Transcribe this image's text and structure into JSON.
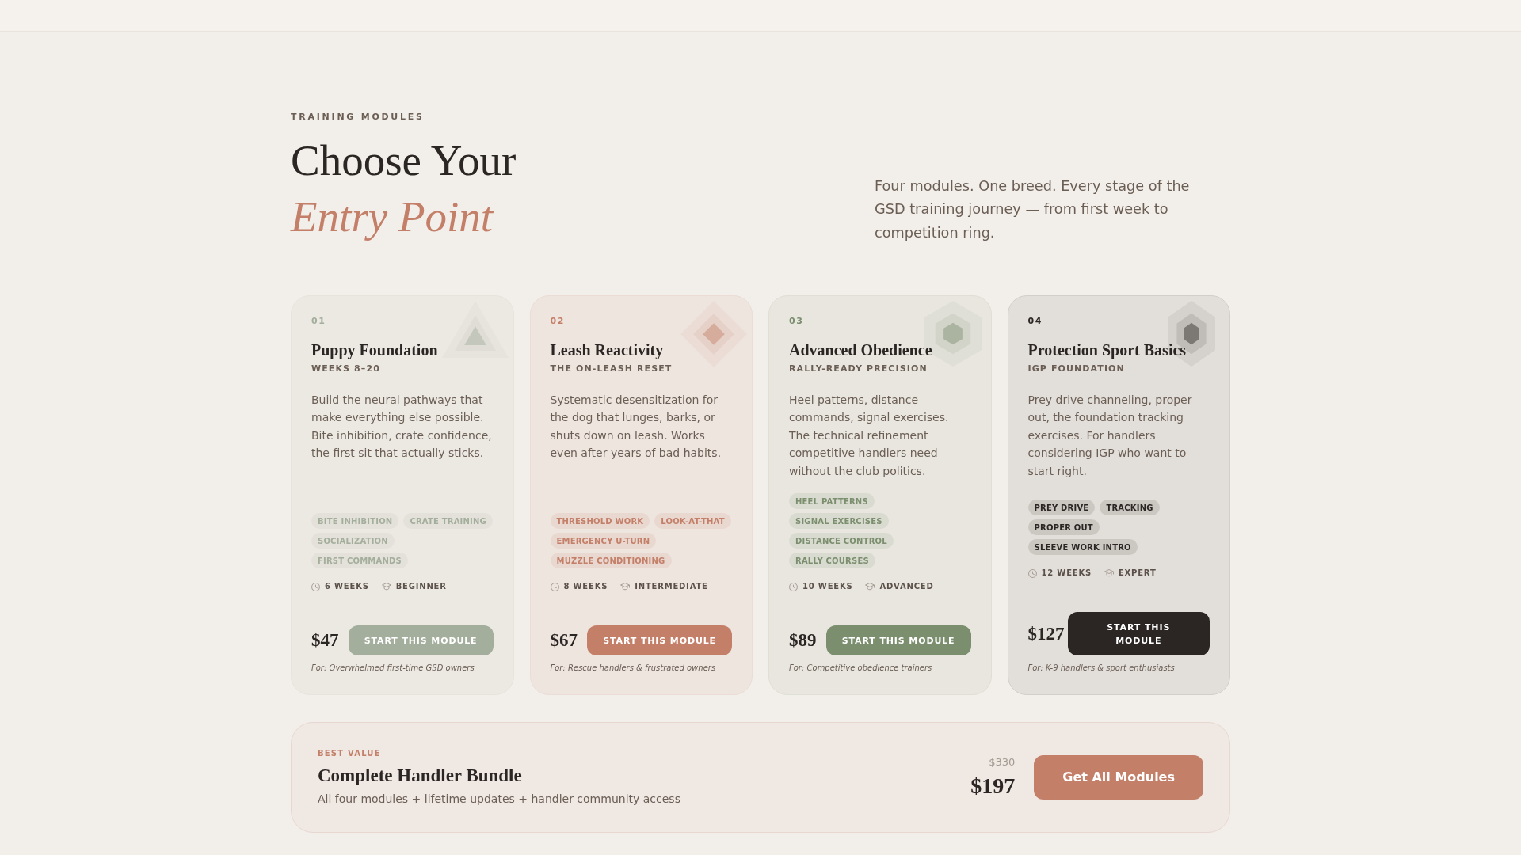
{
  "header": {
    "eyebrow": "TRAINING MODULES",
    "title": "Choose Your *Entry Point*",
    "description": "Four modules. One breed. Every stage of the GSD training journey — from first week to competition ring."
  },
  "modules": [
    {
      "number": "01",
      "kind": "triangle",
      "color": "#a4ae9c",
      "title": "Puppy Foundation",
      "subtitle": "WEEKS 8–20",
      "description": "Build the neural pathways that make everything else possible. Bite inhibition, crate confidence, the first sit that actually sticks.",
      "tags": [
        "BITE INHIBITION",
        "CRATE TRAINING",
        "SOCIALIZATION",
        "FIRST COMMANDS"
      ],
      "duration": "6 WEEKS",
      "difficulty": "BEGINNER",
      "price": "$47",
      "button": "START THIS MODULE",
      "audience": "For: Overwhelmed first-time GSD owners"
    },
    {
      "number": "02",
      "kind": "diamond",
      "color": "#c47f69",
      "title": "Leash Reactivity",
      "subtitle": "THE ON-LEASH RESET",
      "description": "Systematic desensitization for the dog that lunges, barks, or shuts down on leash. Works even after years of bad habits.",
      "tags": [
        "THRESHOLD WORK",
        "LOOK-AT-THAT",
        "EMERGENCY U-TURN",
        "MUZZLE CONDITIONING"
      ],
      "duration": "8 WEEKS",
      "difficulty": "INTERMEDIATE",
      "price": "$67",
      "button": "START THIS MODULE",
      "audience": "For: Rescue handlers & frustrated owners"
    },
    {
      "number": "03",
      "kind": "hexagon",
      "color": "#7b8f6f",
      "title": "Advanced Obedience",
      "subtitle": "RALLY-READY PRECISION",
      "description": "Heel patterns, distance commands, signal exercises. The technical refinement competitive handlers need without the club politics.",
      "tags": [
        "HEEL PATTERNS",
        "SIGNAL EXERCISES",
        "DISTANCE CONTROL",
        "RALLY COURSES"
      ],
      "duration": "10 WEEKS",
      "difficulty": "ADVANCED",
      "price": "$89",
      "button": "START THIS MODULE",
      "audience": "For: Competitive obedience trainers"
    },
    {
      "number": "04",
      "kind": "tall-hexagon",
      "color": "#2b2624",
      "title": "Protection Sport Basics",
      "subtitle": "IGP FOUNDATION",
      "description": "Prey drive channeling, proper out, the foundation tracking exercises. For handlers considering IGP who want to start right.",
      "tags": [
        "PREY DRIVE",
        "TRACKING",
        "PROPER OUT",
        "SLEEVE WORK INTRO"
      ],
      "duration": "12 WEEKS",
      "difficulty": "EXPERT",
      "price": "$127",
      "button": "START THIS MODULE",
      "audience": "For: K-9 handlers & sport enthusiasts"
    }
  ],
  "bundle": {
    "label": "BEST VALUE",
    "title": "Complete Handler Bundle",
    "description": "All four modules + lifetime updates + handler community access",
    "old_price": "$330",
    "price": "$197",
    "button": "Get All Modules"
  }
}
